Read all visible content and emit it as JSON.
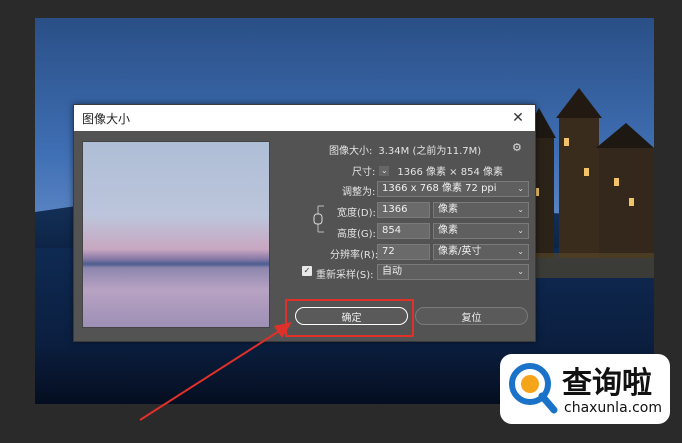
{
  "dialog": {
    "title": "图像大小",
    "image_size_label": "图像大小:",
    "image_size_value": "3.34M (之前为11.7M)",
    "dimensions_label": "尺寸:",
    "dimensions_value": "1366 像素  ×  854 像素",
    "fit_to_label": "调整为:",
    "fit_to_value": "1366 x 768 像素 72 ppi",
    "width_label": "宽度(D):",
    "width_value": "1366",
    "width_unit": "像素",
    "height_label": "高度(G):",
    "height_value": "854",
    "height_unit": "像素",
    "resolution_label": "分辨率(R):",
    "resolution_value": "72",
    "resolution_unit": "像素/英寸",
    "resample_label": "重新采样(S):",
    "resample_value": "自动",
    "ok_label": "确定",
    "reset_label": "复位"
  },
  "watermark": {
    "brand": "查询啦",
    "url": "chaxunla.com"
  },
  "colors": {
    "highlight": "#e0302a",
    "dialog_bg": "#535353"
  }
}
